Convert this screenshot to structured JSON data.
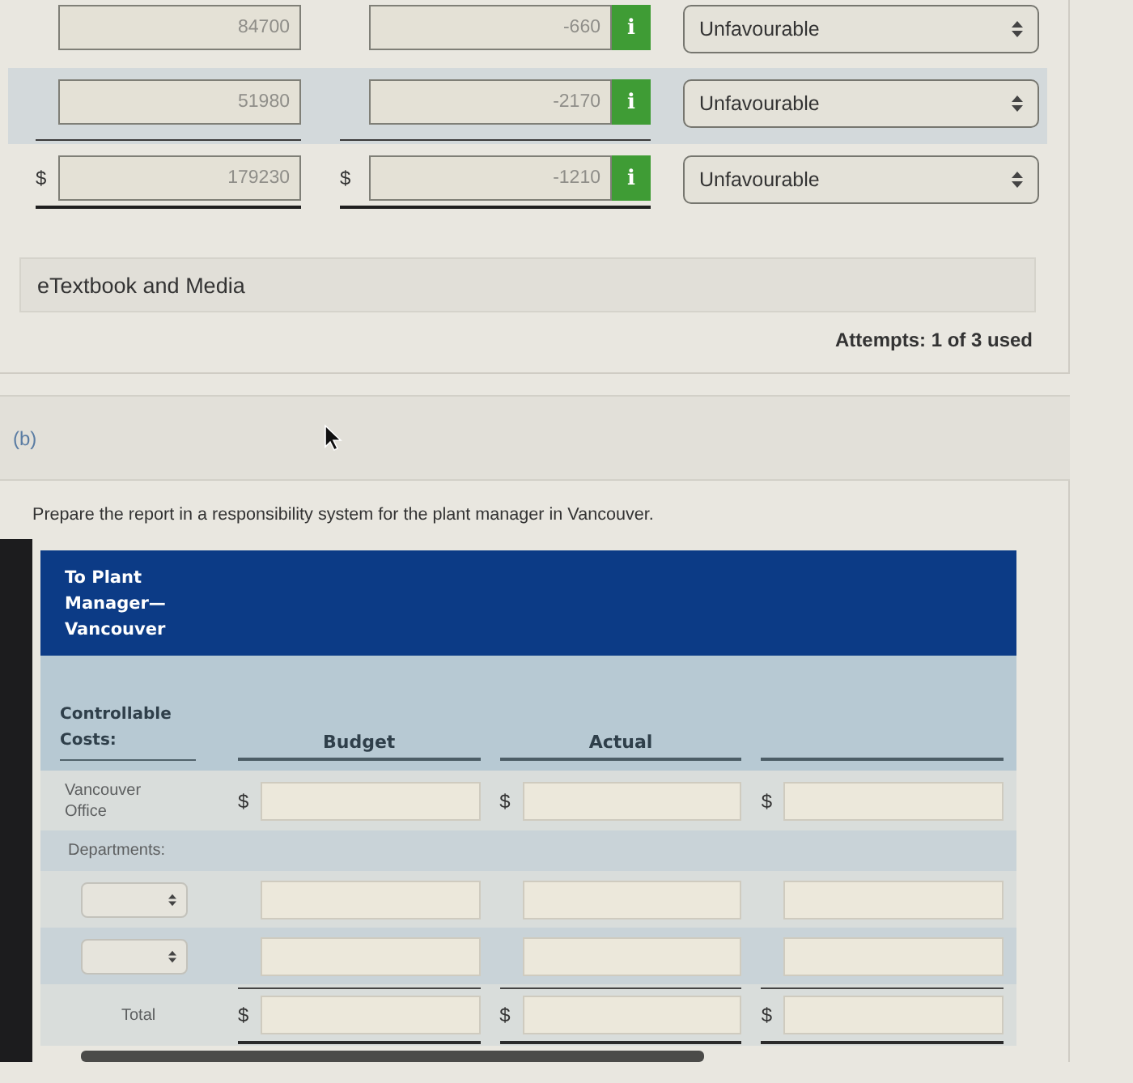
{
  "variance_rows": [
    {
      "kind": "item",
      "amount": "84700",
      "variance": "-660",
      "info": "i",
      "assessment": "Unfavourable"
    },
    {
      "kind": "subtotal",
      "amount": "51980",
      "variance": "-2170",
      "info": "i",
      "assessment": "Unfavourable"
    },
    {
      "kind": "total",
      "currency": "$",
      "amount": "179230",
      "variance_currency": "$",
      "variance": "-1210",
      "info": "i",
      "assessment": "Unfavourable"
    }
  ],
  "media_section": {
    "label": "eTextbook and Media"
  },
  "attempts": "Attempts: 1 of 3 used",
  "part_b": {
    "label": "(b)",
    "instruction": "Prepare the report in a responsibility system for the plant manager in Vancouver.",
    "report": {
      "title": "To Plant Manager—Vancouver",
      "stub_heading": "Controllable Costs:",
      "column_headings": [
        "Budget",
        "Actual"
      ],
      "rows": [
        {
          "kind": "line",
          "label": "Vancouver Office",
          "cells": [
            {
              "currency": "$"
            },
            {
              "currency": "$"
            },
            {
              "currency": "$"
            }
          ]
        },
        {
          "kind": "heading",
          "label": "Departments:"
        },
        {
          "kind": "select"
        },
        {
          "kind": "select"
        },
        {
          "kind": "total",
          "label": "Total",
          "cells": [
            {
              "currency": "$"
            },
            {
              "currency": "$"
            },
            {
              "currency": "$"
            }
          ]
        }
      ]
    }
  }
}
